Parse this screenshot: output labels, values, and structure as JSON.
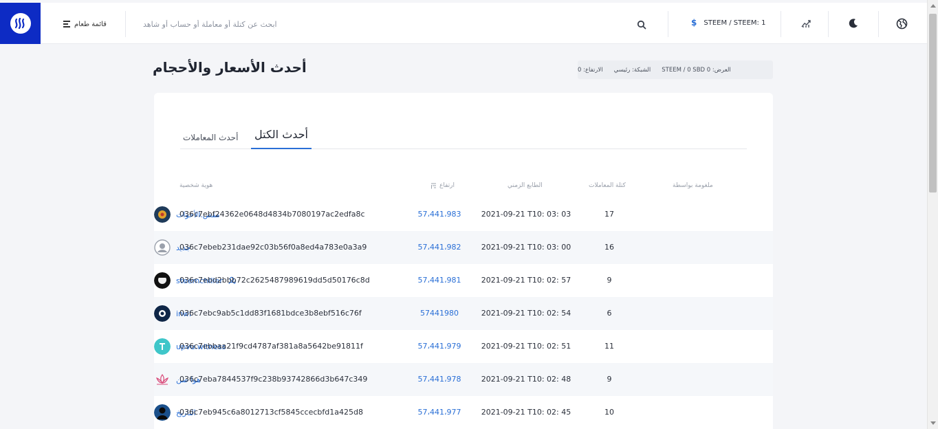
{
  "colors": {
    "accent": "#2a6fd6",
    "logo_bg": "#0d2bc4",
    "page_bg": "#f4f5f8"
  },
  "header": {
    "menu_label": "قائمة طعام",
    "search_placeholder": "ابحث عن كتلة أو معاملة أو حساب أو شاهد",
    "currency_symbol": "$",
    "price_label": "STEEM / STEEM: 1",
    "icons": [
      "steem-logo-icon",
      "menu-icon",
      "search-icon",
      "dollar-icon",
      "chart-icon",
      "moon-icon",
      "globe-icon"
    ]
  },
  "page": {
    "title": "أحدث الأسعار والأحجام",
    "stats": {
      "offer": "العرض: STEEM / 0 SBD 0",
      "network": "الشبكة: رئيسي",
      "height": "الارتفاع: 0"
    }
  },
  "tabs": [
    {
      "label": "أحدث الكتل",
      "active": true
    },
    {
      "label": "أحدث المعاملات",
      "active": false
    }
  ],
  "table": {
    "headers": {
      "witness": "ملغومة بواسطة",
      "tx_count": "كتلة المعاملات",
      "timestamp": "الطابع الزمني",
      "height": "ارتفاع",
      "id": "هوية شخصية"
    },
    "rows": [
      {
        "hash": "036c7ebf24362e0648d4834b7080197ac2edfa8c",
        "height": "57،441،983",
        "time": "2021-09-21 T10: 03: 03",
        "count": "17",
        "witness": "مقص.الأخوات",
        "avatar": "flower"
      },
      {
        "hash": "036c7ebeb231dae92c03b56f0a8ed4a783e0a3a9",
        "height": "57،441،982",
        "time": "2021-09-21 T10: 03: 00",
        "count": "16",
        "witness": "جديد",
        "avatar": "default"
      },
      {
        "hash": "036c7ebd2bbb72c2625487989619dd5d50176c8d",
        "height": "57،441،981",
        "time": "2021-09-21 T10: 02: 57",
        "count": "9",
        "witness": "steemchiller",
        "avatar": "bw",
        "user_icon": true
      },
      {
        "hash": "036c7ebc9ab5c1dd83f1681bdce3b8ebf516c76f",
        "height": "57441980",
        "time": "2021-09-21 T10: 02: 54",
        "count": "6",
        "witness": "inwi",
        "avatar": "navy"
      },
      {
        "hash": "036c7ebbaa21f9cd4787af381a8a5642be91811f",
        "height": "57،441،979",
        "time": "2021-09-21 T10: 02: 51",
        "count": "11",
        "witness": "upvu.witness",
        "avatar": "teal"
      },
      {
        "hash": "036c7eba7844537f9c238b93742866d3b647c349",
        "height": "57،441،978",
        "time": "2021-09-21 T10: 02: 48",
        "count": "9",
        "witness": "هوا صن",
        "avatar": "lotus"
      },
      {
        "hash": "036c7eb945c6a8012713cf5845ccecbfd1a425d8",
        "height": "57،441،977",
        "time": "2021-09-21 T10: 02: 45",
        "count": "10",
        "witness": "التاريخ",
        "avatar": "dark"
      }
    ]
  }
}
